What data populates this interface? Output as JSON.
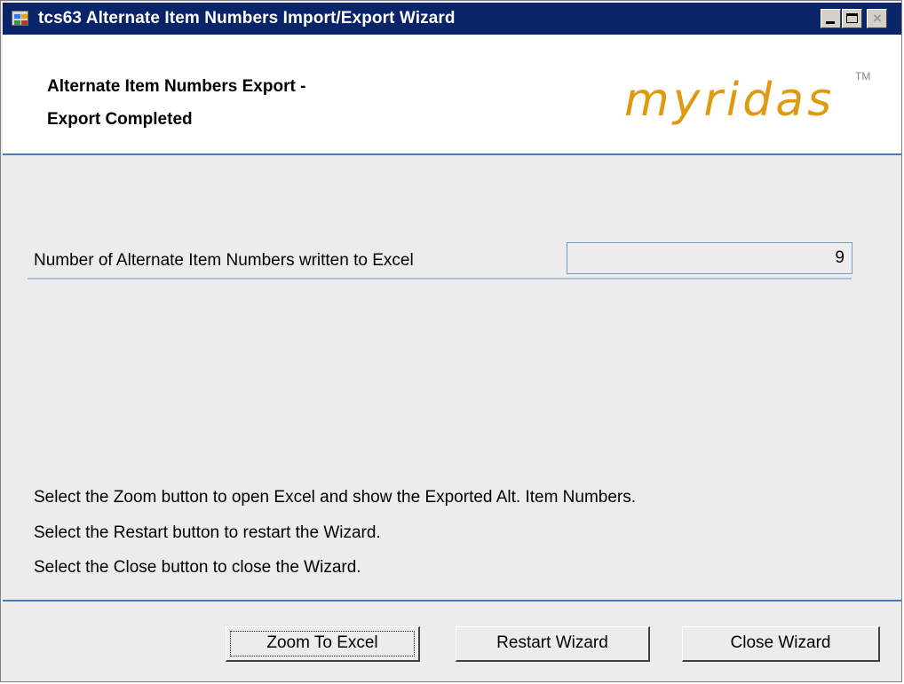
{
  "window": {
    "title": "tcs63 Alternate Item Numbers Import/Export Wizard",
    "app_icon": "app-window-icon",
    "controls": {
      "minimize_icon": "minimize-icon",
      "maximize_icon": "maximize-icon",
      "close_icon": "close-icon",
      "close_glyph": "×"
    }
  },
  "header": {
    "title_line1": "Alternate Item Numbers Export -",
    "title_line2": "Export Completed",
    "logo_text": "myridas",
    "trademark": "TM",
    "logo_color": "#e09a10"
  },
  "result": {
    "label": "Number of Alternate Item Numbers written to Excel",
    "count": "9"
  },
  "instructions": [
    "Select the Zoom button to open Excel and show the Exported Alt. Item Numbers.",
    "Select the Restart button to restart the Wizard.",
    "Select the Close button to close the Wizard."
  ],
  "buttons": {
    "zoom_label": "Zoom To Excel",
    "restart_label": "Restart Wizard",
    "close_label": "Close Wizard"
  },
  "colors": {
    "titlebar": "#0a246a",
    "accent_line": "#4a7ab5",
    "background": "#ececec"
  }
}
